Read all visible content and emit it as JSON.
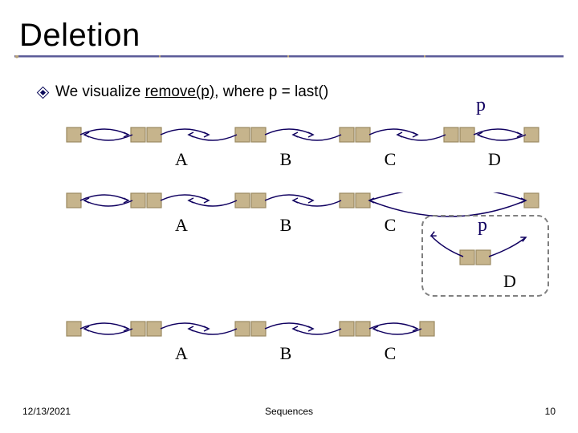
{
  "title": "Deletion",
  "bullet": {
    "prefix": "We visualize ",
    "method": "remove(p)",
    "suffix": ", where p = last()"
  },
  "p_label": "p",
  "rows": [
    "A",
    "B",
    "C",
    "D"
  ],
  "rows2": [
    "A",
    "B",
    "C"
  ],
  "rows3": [
    "A",
    "B",
    "C"
  ],
  "removed": {
    "p": "p",
    "D": "D"
  },
  "footer": {
    "date": "12/13/2021",
    "title": "Sequences",
    "page": "10"
  },
  "colors": {
    "title_underline": "#5b5b98",
    "dash": "#808080",
    "node_fill": "#c6b48c",
    "node_stroke": "#9a8960",
    "arrow": "#100060",
    "link_stroke": "#100060",
    "removed_border": "#808080"
  }
}
